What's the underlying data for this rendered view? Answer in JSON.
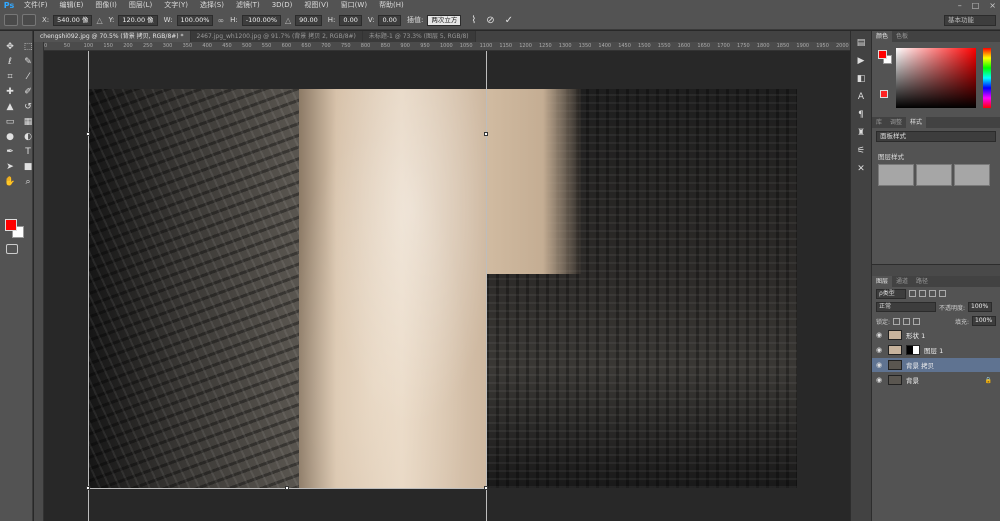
{
  "app": {
    "logo": "Ps"
  },
  "menu": [
    "文件(F)",
    "编辑(E)",
    "图像(I)",
    "图层(L)",
    "文字(Y)",
    "选择(S)",
    "滤镜(T)",
    "3D(D)",
    "视图(V)",
    "窗口(W)",
    "帮助(H)"
  ],
  "window_controls": {
    "minimize": "–",
    "maximize": "□",
    "close": "×"
  },
  "options": {
    "x_label": "X:",
    "x_value": "540.00 像",
    "y_label": "Y:",
    "y_value": "120.00 像",
    "w_label": "W:",
    "w_value": "100.00%",
    "h_label": "H:",
    "h_value": "-100.00%",
    "angle_value": "90.00",
    "hskew_label": "H:",
    "hskew_value": "0.00",
    "vskew_label": "V:",
    "vskew_value": "0.00",
    "interp_label": "插值:",
    "interp_value": "两次立方",
    "workspace": "基本功能"
  },
  "tabs": [
    {
      "label": "chengshi092.jpg @ 70.5% (背景 拷贝, RGB/8#) *",
      "active": true
    },
    {
      "label": "2467.jpg_wh1200.jpg @ 91.7% (背景 拷贝 2, RGB/8#)",
      "active": false
    },
    {
      "label": "未标题-1 @ 73.3% (图层 5, RGB/8)",
      "active": false
    }
  ],
  "ruler_top": [
    "0",
    "50",
    "100",
    "150",
    "200",
    "250",
    "300",
    "350",
    "400",
    "450",
    "500",
    "550",
    "600",
    "650",
    "700",
    "750",
    "800",
    "850",
    "900",
    "950",
    "1000",
    "1050",
    "1100",
    "1150",
    "1200",
    "1250",
    "1300",
    "1350",
    "1400",
    "1450",
    "1500",
    "1550",
    "1600",
    "1650",
    "1700",
    "1750",
    "1800",
    "1850",
    "1900",
    "1950",
    "2000"
  ],
  "panels": {
    "color_tabs": [
      "颜色",
      "色板"
    ],
    "style_tabs": [
      "库",
      "调整",
      "样式"
    ],
    "style_select": "面板样式",
    "style_label": "图层样式",
    "layer_tabs": [
      "图层",
      "通道",
      "路径"
    ],
    "kind_select": "ρ类型",
    "blend_mode": "正常",
    "opacity_label": "不透明度:",
    "opacity_value": "100%",
    "lock_label": "锁定:",
    "fill_label": "填充:",
    "fill_value": "100%",
    "layers": [
      {
        "name": "形状 1",
        "selected": false
      },
      {
        "name": "图层 1",
        "selected": false
      },
      {
        "name": "背景 拷贝",
        "selected": true
      },
      {
        "name": "背景",
        "selected": false
      }
    ]
  },
  "colors": {
    "foreground": "#ff0000",
    "background": "#ffffff",
    "ps_blue": "#31a8ff",
    "selection": "#5f7391"
  }
}
